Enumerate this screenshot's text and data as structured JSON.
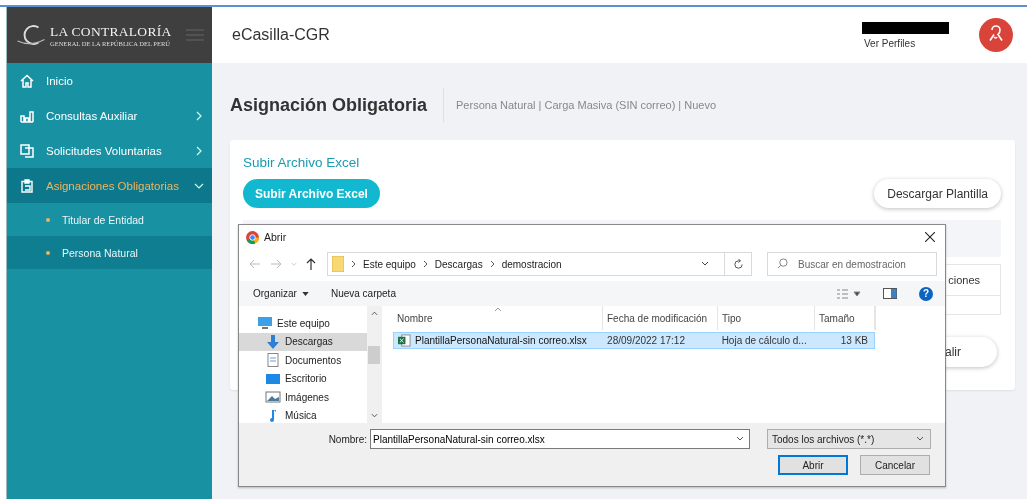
{
  "app": {
    "logo_title": "LA CONTRALORÍA",
    "logo_subtitle": "GENERAL DE LA REPÚBLICA DEL PERÚ",
    "name": "eCasilla-CGR",
    "profile_link": "Ver Perfiles"
  },
  "sidebar": {
    "items": [
      {
        "label": "Inicio",
        "kind": "link",
        "selected": false
      },
      {
        "label": "Consultas Auxiliar",
        "kind": "group",
        "selected": false,
        "expanded": false
      },
      {
        "label": "Solicitudes Voluntarias",
        "kind": "group",
        "selected": false,
        "expanded": false
      },
      {
        "label": "Asignaciones Obligatorias",
        "kind": "group",
        "selected": true,
        "expanded": true,
        "children": [
          {
            "label": "Titular de Entidad",
            "selected": false
          },
          {
            "label": "Persona Natural",
            "selected": true
          }
        ]
      }
    ]
  },
  "page": {
    "title": "Asignación Obligatoria",
    "breadcrumb": "Persona Natural | Carga Masiva (SIN correo) | Nuevo",
    "card": {
      "section_title": "Subir Archivo Excel",
      "upload_button": "Subir Archivo Excel",
      "download_button": "Descargar Plantilla",
      "column_partial": "ciones",
      "button_partial": "alir"
    }
  },
  "dialog": {
    "title": "Abrir",
    "path": [
      "Este equipo",
      "Descargas",
      "demostracion"
    ],
    "search_placeholder": "Buscar en demostracion",
    "toolbar": [
      "Organizar",
      "Nueva carpeta"
    ],
    "help": "?",
    "nav_items": [
      {
        "label": "Este equipo",
        "selected": false,
        "indent": false
      },
      {
        "label": "Descargas",
        "selected": true,
        "indent": true
      },
      {
        "label": "Documentos",
        "selected": false,
        "indent": true
      },
      {
        "label": "Escritorio",
        "selected": false,
        "indent": true
      },
      {
        "label": "Imágenes",
        "selected": false,
        "indent": true
      },
      {
        "label": "Música",
        "selected": false,
        "indent": true
      }
    ],
    "columns": [
      "Nombre",
      "Fecha de modificación",
      "Tipo",
      "Tamaño"
    ],
    "files": [
      {
        "name": "PlantillaPersonaNatural-sin correo.xlsx",
        "date": "28/09/2022 17:12",
        "type": "Hoja de cálculo d...",
        "size": "13 KB",
        "selected": true
      }
    ],
    "filename_label": "Nombre:",
    "filename": "PlantillaPersonaNatural-sin correo.xlsx",
    "filter": "Todos los archivos (*.*)",
    "open_button": "Abrir",
    "cancel_button": "Cancelar"
  }
}
